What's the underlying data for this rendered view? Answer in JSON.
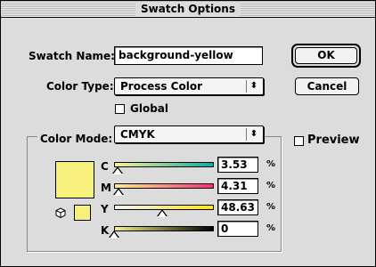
{
  "window": {
    "title": "Swatch Options"
  },
  "swatch_name": {
    "label": "Swatch Name:",
    "value": "background-yellow"
  },
  "color_type": {
    "label": "Color Type:",
    "value": "Process Color"
  },
  "global": {
    "label": "Global",
    "checked": false
  },
  "color_mode": {
    "label": "Color Mode:",
    "value": "CMYK"
  },
  "buttons": {
    "ok": "OK",
    "cancel": "Cancel"
  },
  "preview": {
    "label": "Preview",
    "checked": false
  },
  "swatch_color": "#f8f07c",
  "sliders": [
    {
      "channel": "C",
      "value": "3.53",
      "fraction": 0.0353,
      "gradient": [
        "#fff27e",
        "#00b0b0"
      ]
    },
    {
      "channel": "M",
      "value": "4.31",
      "fraction": 0.0431,
      "gradient": [
        "#fff27e",
        "#ff2a7a"
      ]
    },
    {
      "channel": "Y",
      "value": "48.63",
      "fraction": 0.4863,
      "gradient": [
        "#f4f3fa",
        "#ffe600"
      ]
    },
    {
      "channel": "K",
      "value": "0",
      "fraction": 0.0,
      "gradient": [
        "#f8f07c",
        "#000000"
      ]
    }
  ],
  "percent_symbol": "%",
  "icons": {
    "out_of_gamut": "cube-icon",
    "popup_arrow": "updown-arrow-icon"
  }
}
